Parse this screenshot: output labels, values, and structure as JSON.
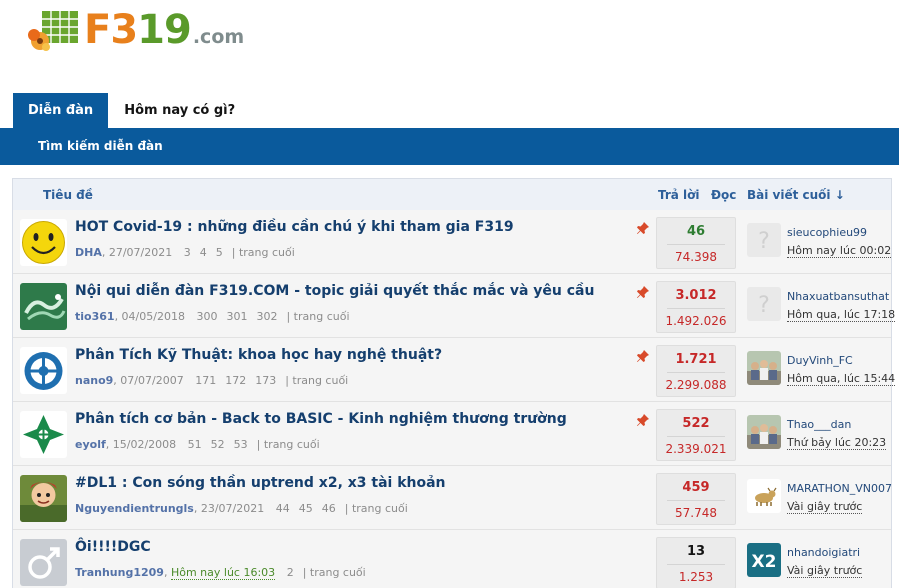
{
  "logo": {
    "f": "F",
    "three": "3",
    "nineteen": "19",
    "dotcom": ".com"
  },
  "nav": {
    "tabs": [
      "Diễn đàn",
      "Hôm nay có gì?"
    ],
    "sub_link": "Tìm kiếm diễn đàn"
  },
  "header": {
    "title": "Tiêu đề",
    "replies": "Trả lời",
    "views": "Đọc",
    "last_post": "Bài viết cuối ↓"
  },
  "colors": {
    "primary": "#0a5a9c",
    "title": "#153f6e",
    "views": "#c62828"
  },
  "threads": [
    {
      "title": "HOT Covid-19 : những điều cần chú ý khi tham gia F319",
      "author": "DHA",
      "date": ", 27/07/2021",
      "pages": [
        "3",
        "4",
        "5"
      ],
      "last_page": "| trang cuối",
      "pinned": true,
      "replies": "46",
      "replies_color": "#2e7d32",
      "views": "74.398",
      "last_user": "sieucophieu99",
      "last_time": "Hôm nay lúc 00:02",
      "avatar_icon": "smiley-icon",
      "last_avatar_icon": "default-avatar-icon"
    },
    {
      "title": "Nội qui diễn đàn F319.COM - topic giải quyết thắc mắc và yêu cầu",
      "author": "tio361",
      "date": ", 04/05/2018",
      "pages": [
        "300",
        "301",
        "302"
      ],
      "last_page": "| trang cuối",
      "pinned": true,
      "replies": "3.012",
      "replies_color": "#c62828",
      "views": "1.492.026",
      "last_user": "Nhaxuatbansuthat",
      "last_time": "Hôm qua, lúc 17:18",
      "avatar_icon": "dragon-icon",
      "last_avatar_icon": "default-avatar-icon"
    },
    {
      "title": "Phân Tích Kỹ Thuật: khoa học hay nghệ thuật?",
      "author": "nano9",
      "date": ", 07/07/2007",
      "pages": [
        "171",
        "172",
        "173"
      ],
      "last_page": "| trang cuối",
      "pinned": true,
      "replies": "1.721",
      "replies_color": "#c62828",
      "views": "2.299.088",
      "last_user": "DuyVinh_FC",
      "last_time": "Hôm qua, lúc 15:44",
      "avatar_icon": "bank-logo-icon",
      "last_avatar_icon": "group-photo-icon"
    },
    {
      "title": "Phân tích cơ bản - Back to BASIC - Kinh nghiệm thương trường",
      "author": "eyolf",
      "date": ", 15/02/2008",
      "pages": [
        "51",
        "52",
        "53"
      ],
      "last_page": "| trang cuối",
      "pinned": true,
      "replies": "522",
      "replies_color": "#c62828",
      "views": "2.339.021",
      "last_user": "Thao___dan",
      "last_time": "Thứ bảy lúc 20:23",
      "avatar_icon": "leaf-logo-icon",
      "last_avatar_icon": "group-photo-icon"
    },
    {
      "title": "#DL1 : Con sóng thần uptrend x2, x3 tài khoản",
      "author": "Nguyendientrungls",
      "date": ", 23/07/2021",
      "pages": [
        "44",
        "45",
        "46"
      ],
      "last_page": "| trang cuối",
      "pinned": false,
      "replies": "459",
      "replies_color": "#c62828",
      "views": "57.748",
      "last_user": "MARATHON_VN007",
      "last_time": "Vài giây trước",
      "avatar_icon": "cartoon-avatar-icon",
      "last_avatar_icon": "bull-icon"
    },
    {
      "title": "Ôi!!!!DGC",
      "author": "Tranhung1209",
      "date_green": "Hôm nay lúc 16:03",
      "pages": [
        "2"
      ],
      "last_page": "| trang cuối",
      "pinned": false,
      "replies": "13",
      "replies_color": "#141414",
      "views": "1.253",
      "last_user": "nhandoigiatri",
      "last_time": "Vài giây trước",
      "avatar_icon": "male-symbol-icon",
      "last_avatar_icon": "x2-logo-icon"
    }
  ]
}
